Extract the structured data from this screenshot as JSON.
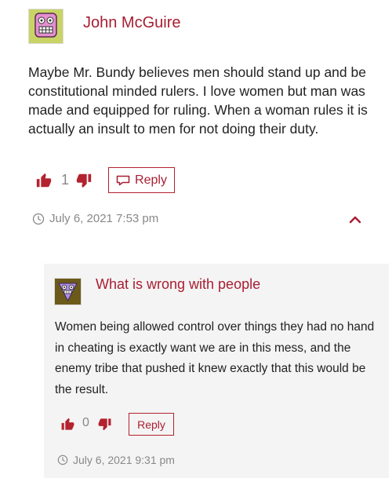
{
  "comments": [
    {
      "author": "John McGuire",
      "text": "Maybe Mr. Bundy believes men should stand up and be constitutional minded rulers. I love women but man was made and equipped for ruling. When a woman rules it is actually an insult to men for not doing their duty.",
      "likes": "1",
      "reply_label": "Reply",
      "timestamp": "July 6, 2021 7:53 pm",
      "avatar_icon": "monster-face-icon"
    },
    {
      "author": "What is wrong with people",
      "text": "Women being allowed control over things they had no hand in cheating is exactly want we are in this mess, and the enemy tribe that pushed it knew exactly that this would be the result.",
      "likes": "0",
      "reply_label": "Reply",
      "timestamp": "July 6, 2021 9:31 pm",
      "avatar_icon": "monster-face-icon"
    }
  ],
  "colors": {
    "accent": "#a81e32",
    "muted": "#888888",
    "reply_bg": "#f4f4f4"
  }
}
